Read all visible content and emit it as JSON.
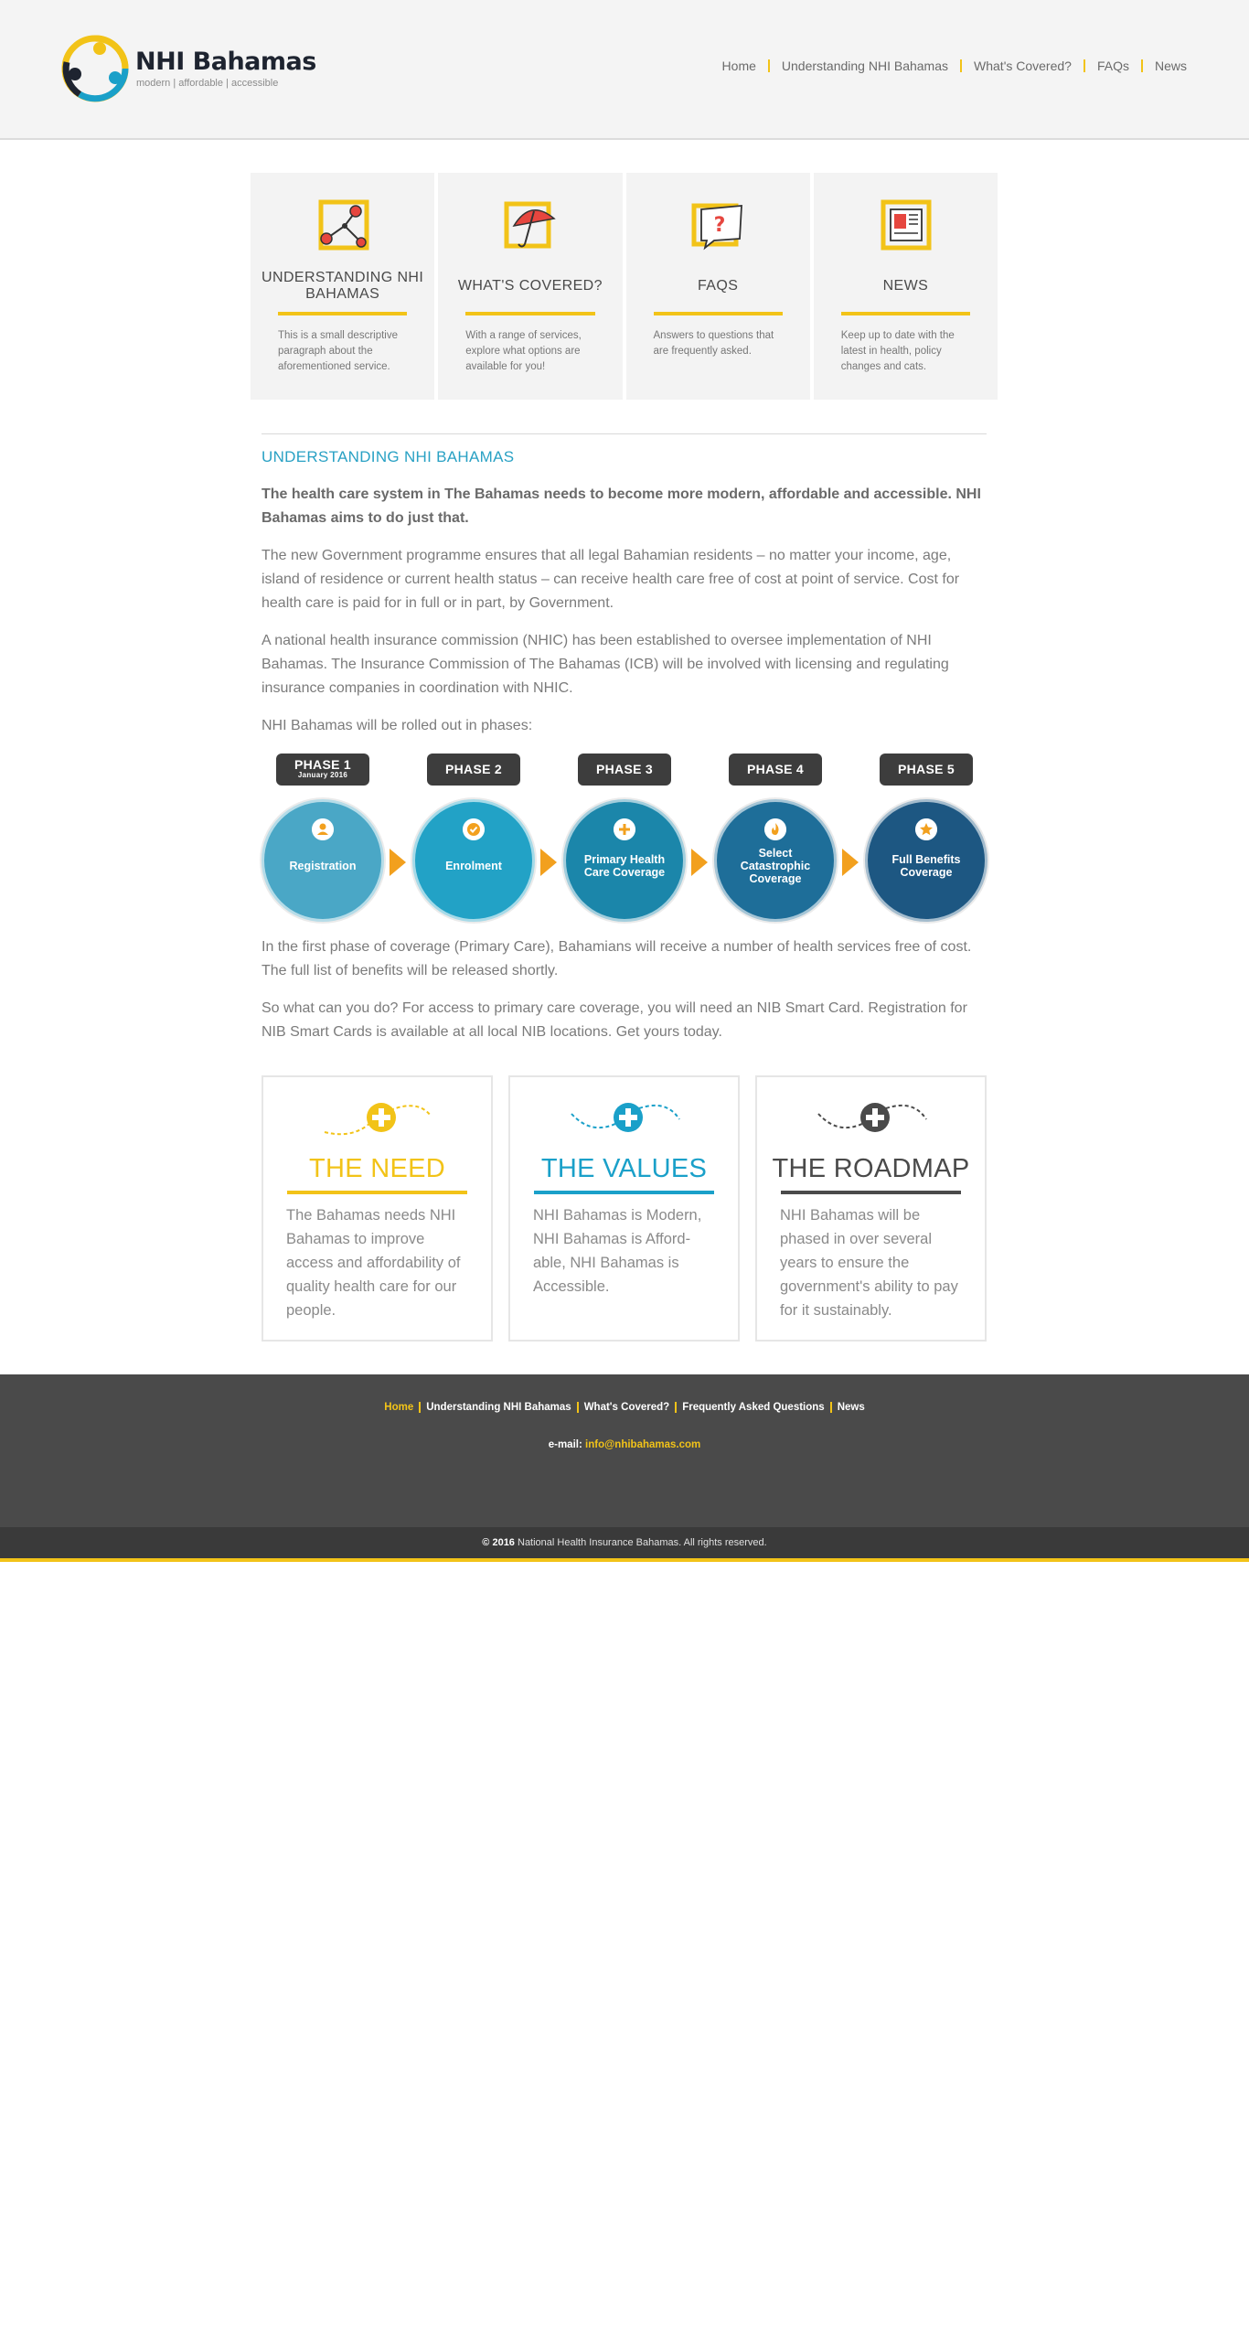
{
  "header": {
    "brand": "NHI Bahamas",
    "tagline": "modern  |  affordable  |  accessible",
    "nav": [
      "Home",
      "Understanding NHI Bahamas",
      "What's Covered?",
      "FAQs",
      "News"
    ]
  },
  "tiles": [
    {
      "icon": "network-icon",
      "title": "UNDERSTANDING NHI BAHAMAS",
      "desc": "This is a small descriptive paragraph about the aforementioned service."
    },
    {
      "icon": "umbrella-icon",
      "title": "WHAT'S COVERED?",
      "desc": "With a range of services, explore what options are available for you!"
    },
    {
      "icon": "question-icon",
      "title": "FAQS",
      "desc": "Answers to questions that are frequently asked."
    },
    {
      "icon": "newspaper-icon",
      "title": "NEWS",
      "desc": "Keep up to date with the latest in health, policy changes and cats."
    }
  ],
  "main": {
    "heading": "UNDERSTANDING NHI BAHAMAS",
    "lead": "The health care system in The Bahamas needs to become more modern, affordable and accessible. NHI Bahamas aims to do just that.",
    "p1": "The new Government programme ensures that all legal Bahamian residents – no matter your income, age, island of residence or current health status – can receive health care free of cost at point of service. Cost for health care is paid for in full or in part, by Government.",
    "p2": "A national health insurance commission (NHIC) has been established to oversee implementation of NHI Bahamas. The Insurance Commission of The Bahamas (ICB) will be involved with licensing and regulating insurance companies in coordination with NHIC.",
    "p3": "NHI Bahamas will be rolled out in phases:",
    "p4": "In the first phase of coverage (Primary Care), Bahamians will receive a number of health services free of cost. The full list of benefits will be released shortly.",
    "p5": "So what can you do? For access to primary care coverage, you will need an NIB Smart Card. Registration for NIB Smart Cards is available at all local NIB locations. Get yours today."
  },
  "phases": [
    {
      "badge": "PHASE 1",
      "sub": "January 2016",
      "label": "Registration",
      "icon": "person-icon",
      "color": "#4aa7c6"
    },
    {
      "badge": "PHASE 2",
      "sub": "",
      "label": "Enrolment",
      "icon": "check-icon",
      "color": "#22a2c6"
    },
    {
      "badge": "PHASE 3",
      "sub": "",
      "label": "Primary Health Care Coverage",
      "icon": "plus-icon",
      "color": "#1b86aa"
    },
    {
      "badge": "PHASE 4",
      "sub": "",
      "label": "Select Catastrophic Coverage",
      "icon": "flame-icon",
      "color": "#1e6e99"
    },
    {
      "badge": "PHASE 5",
      "sub": "",
      "label": "Full Benefits Coverage",
      "icon": "star-icon",
      "color": "#1d5782"
    }
  ],
  "cards": [
    {
      "title": "THE NEED",
      "color": "#f2c318",
      "desc": "The Bahamas needs NHI Bahamas to improve access and affordability of quality health care for our people."
    },
    {
      "title": "THE VALUES",
      "color": "#1aa0c9",
      "desc": "NHI Bahamas is Modern, NHI Bahamas is Afford-able, NHI Bahamas is Accessible."
    },
    {
      "title": "THE ROADMAP",
      "color": "#4a4a4a",
      "desc": "NHI Bahamas will be phased in over several years to ensure the government's ability to pay for it sustainably."
    }
  ],
  "footer": {
    "nav": [
      "Home",
      "Understanding NHI Bahamas",
      "What's Covered?",
      "Frequently Asked Questions",
      "News"
    ],
    "email_label": "e-mail:",
    "email": "info@nhibahamas.com",
    "copyright_year": "© 2016",
    "copyright_text": "National Health Insurance Bahamas. All rights reserved."
  },
  "colors": {
    "accent": "#f2c318",
    "blue": "#29a1c4",
    "arrow": "#f2a01e"
  }
}
